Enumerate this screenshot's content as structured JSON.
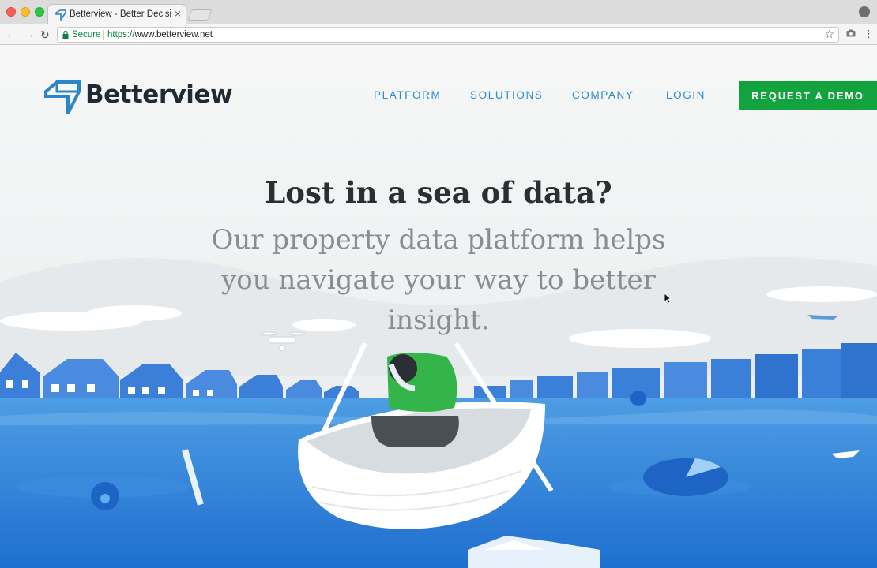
{
  "browser": {
    "tab_title": "Betterview - Better Decisions with Better Data",
    "tab_close": "×",
    "secure_label": "Secure",
    "url_scheme": "https://",
    "url_host": "www.betterview.net",
    "star": "☆",
    "menu": "⋮",
    "back": "←",
    "forward": "→",
    "reload": "↻"
  },
  "site": {
    "logo_text": "Betterview",
    "nav": [
      {
        "label": "PLATFORM"
      },
      {
        "label": "SOLUTIONS"
      },
      {
        "label": "COMPANY"
      },
      {
        "label": "LOGIN"
      }
    ],
    "cta_label": "REQUEST A DEMO",
    "brand_color": "#12a23e",
    "link_color": "#2a8bc7"
  },
  "hero": {
    "headline": "Lost in a sea of data?",
    "subline": "Our property data platform helps you navigate your way to better insight."
  }
}
